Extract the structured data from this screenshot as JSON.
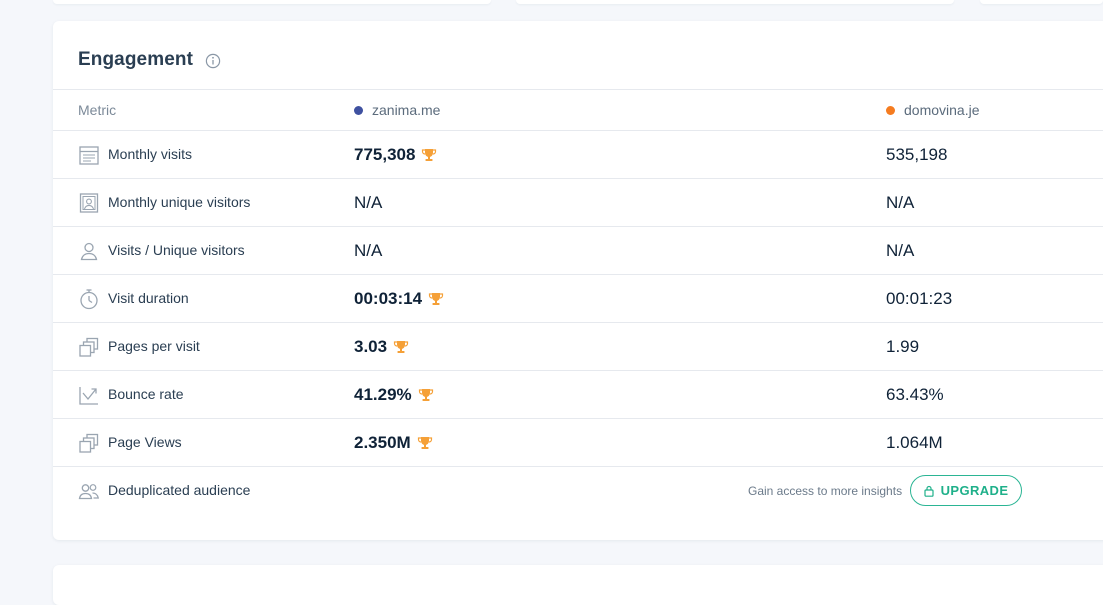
{
  "card": {
    "title": "Engagement",
    "info_icon": "info-circle-icon"
  },
  "table": {
    "header": {
      "metric": "Metric",
      "sites": [
        {
          "name": "zanima.me",
          "color": "#3f51a0"
        },
        {
          "name": "domovina.je",
          "color": "#f57c20"
        }
      ]
    },
    "rows": [
      {
        "label": "Monthly visits",
        "icon": "calendar-icon",
        "a": "775,308",
        "a_winner": true,
        "b": "535,198"
      },
      {
        "label": "Monthly unique visitors",
        "icon": "user-badge-icon",
        "a": "N/A",
        "a_winner": false,
        "b": "N/A"
      },
      {
        "label": "Visits / Unique visitors",
        "icon": "user-icon",
        "a": "N/A",
        "a_winner": false,
        "b": "N/A"
      },
      {
        "label": "Visit duration",
        "icon": "stopwatch-icon",
        "a": "00:03:14",
        "a_winner": true,
        "b": "00:01:23"
      },
      {
        "label": "Pages per visit",
        "icon": "pages-icon",
        "a": "3.03",
        "a_winner": true,
        "b": "1.99"
      },
      {
        "label": "Bounce rate",
        "icon": "bounce-arrow-icon",
        "a": "41.29%",
        "a_winner": true,
        "b": "63.43%"
      },
      {
        "label": "Page Views",
        "icon": "pages-icon",
        "a": "2.350M",
        "a_winner": true,
        "b": "1.064M"
      }
    ],
    "dedup": {
      "label": "Deduplicated audience",
      "icon": "users-icon",
      "gain_text": "Gain access to more insights",
      "upgrade_label": "UPGRADE",
      "lock_icon": "lock-icon"
    }
  },
  "colors": {
    "trophy": "#f5a037",
    "accent_green": "#1fb08a"
  }
}
